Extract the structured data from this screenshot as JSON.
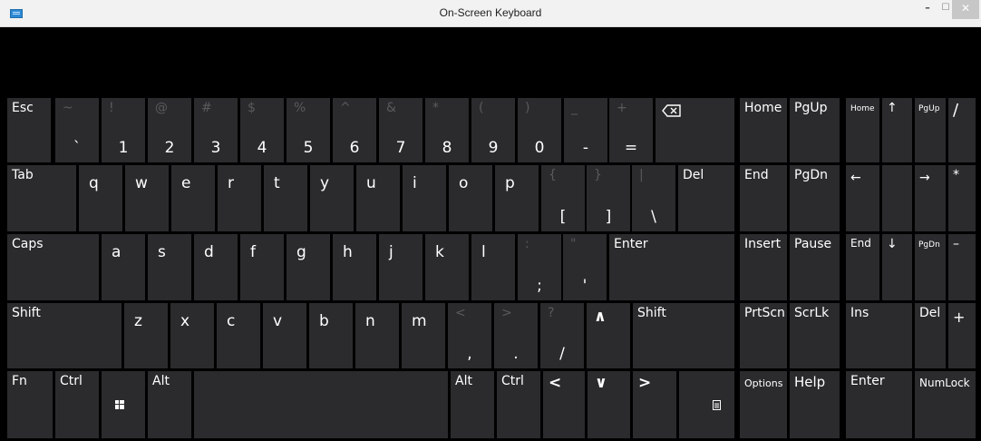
{
  "window": {
    "title": "On-Screen Keyboard",
    "min_glyph": "–",
    "max_glyph": "☐",
    "close_glyph": "✕"
  },
  "rows": {
    "num": [
      {
        "name": "key-esc",
        "label": "Esc",
        "shift": "",
        "primary": ""
      },
      {
        "name": "key-backtick",
        "label": "",
        "shift": "~",
        "primary": "`"
      },
      {
        "name": "key-1",
        "label": "",
        "shift": "!",
        "primary": "1"
      },
      {
        "name": "key-2",
        "label": "",
        "shift": "@",
        "primary": "2"
      },
      {
        "name": "key-3",
        "label": "",
        "shift": "#",
        "primary": "3"
      },
      {
        "name": "key-4",
        "label": "",
        "shift": "$",
        "primary": "4"
      },
      {
        "name": "key-5",
        "label": "",
        "shift": "%",
        "primary": "5"
      },
      {
        "name": "key-6",
        "label": "",
        "shift": "^",
        "primary": "6"
      },
      {
        "name": "key-7",
        "label": "",
        "shift": "&",
        "primary": "7"
      },
      {
        "name": "key-8",
        "label": "",
        "shift": "*",
        "primary": "8"
      },
      {
        "name": "key-9",
        "label": "",
        "shift": "(",
        "primary": "9"
      },
      {
        "name": "key-0",
        "label": "",
        "shift": ")",
        "primary": "0"
      },
      {
        "name": "key-minus",
        "label": "",
        "shift": "_",
        "primary": "-"
      },
      {
        "name": "key-equals",
        "label": "",
        "shift": "+",
        "primary": "="
      }
    ],
    "qwerty": [
      "q",
      "w",
      "e",
      "r",
      "t",
      "y",
      "u",
      "i",
      "o",
      "p"
    ],
    "brackets": [
      {
        "name": "key-open-bracket",
        "shift": "{",
        "primary": "["
      },
      {
        "name": "key-close-bracket",
        "shift": "}",
        "primary": "]"
      },
      {
        "name": "key-backslash",
        "shift": "|",
        "primary": "\\"
      }
    ],
    "home": [
      "a",
      "s",
      "d",
      "f",
      "g",
      "h",
      "j",
      "k",
      "l"
    ],
    "home_punct": [
      {
        "name": "key-semicolon",
        "shift": ":",
        "primary": ";"
      },
      {
        "name": "key-quote",
        "shift": "\"",
        "primary": "'"
      }
    ],
    "bottom_letters": [
      "z",
      "x",
      "c",
      "v",
      "b",
      "n",
      "m"
    ],
    "bottom_punct": [
      {
        "name": "key-comma",
        "shift": "<",
        "primary": ","
      },
      {
        "name": "key-period",
        "shift": ">",
        "primary": "."
      },
      {
        "name": "key-slash",
        "shift": "?",
        "primary": "/"
      }
    ]
  },
  "labels": {
    "tab": "Tab",
    "del": "Del",
    "caps": "Caps",
    "enter": "Enter",
    "shift": "Shift",
    "fn": "Fn",
    "ctrl": "Ctrl",
    "alt": "Alt",
    "alt_right": "Alt",
    "ctrl_right": "Ctrl"
  },
  "nav": {
    "home": "Home",
    "pgup": "PgUp",
    "end": "End",
    "pgdn": "PgDn",
    "insert": "Insert",
    "pause": "Pause",
    "prtscn": "PrtScn",
    "scrlk": "ScrLk",
    "options": "Options",
    "help": "Help"
  },
  "numpad": {
    "home": "Home",
    "up": "↑",
    "pgup": "PgUp",
    "slash": "/",
    "left": "←",
    "right": "→",
    "star": "*",
    "end": "End",
    "down": "↓",
    "pgdn": "PgDn",
    "minus": "–",
    "ins": "Ins",
    "del": "Del",
    "plus": "+",
    "enter": "Enter",
    "numlock": "NumLock"
  },
  "arrows": {
    "left": "<",
    "down": "∨",
    "right": ">",
    "up": "∧"
  }
}
